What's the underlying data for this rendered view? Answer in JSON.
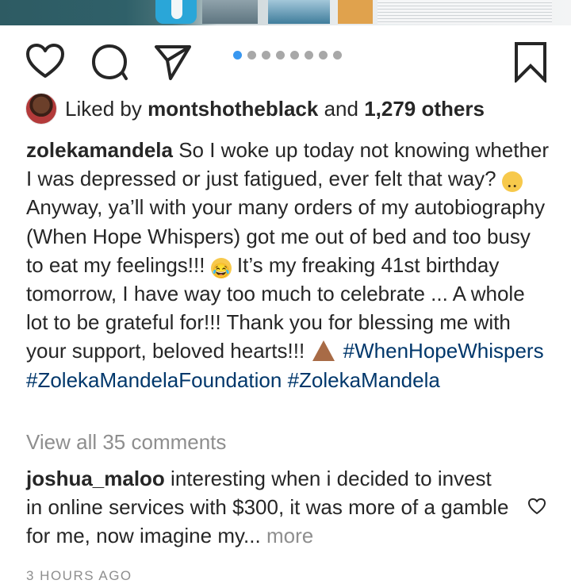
{
  "post": {
    "liked_by_prefix": "Liked by",
    "liked_by_user": "montshotheblack",
    "liked_by_joiner": "and",
    "liked_by_others": "1,279 others",
    "carousel": {
      "total": 8,
      "active_index": 0
    }
  },
  "caption": {
    "username": "zolekamandela",
    "part1": " So I woke up today not knowing whether I was depressed or just fatigued, ever felt that way? ",
    "emoji1": "flushed-face",
    "part2": " Anyway, ya’ll with your many orders of my autobiography (When Hope Whispers) got me out of bed and too busy to eat my feelings!!! ",
    "emoji2": "rolling-laughing-face",
    "part3": " It’s my freaking 41st birthday tomorrow, I have way too much to celebrate ... A whole lot to be grateful for!!! Thank you for blessing me with your support, beloved hearts!!! ",
    "emoji3": "folded-hands",
    "hashtags": [
      "#WhenHopeWhispers",
      "#ZolekaMandelaFoundation",
      "#ZolekaMandela"
    ]
  },
  "view_all_comments": "View all 35 comments",
  "comment": {
    "username": "joshua_maloo",
    "text": " interesting when i decided to invest in online services with $300, it was more of a gamble for me, now imagine my...",
    "more": "more"
  },
  "timestamp": "3 HOURS AGO",
  "colors": {
    "link": "#00376b",
    "accent_dot": "#3897f0",
    "muted": "#8e8e8e"
  },
  "icons": [
    "heart-icon",
    "comment-icon",
    "share-icon",
    "bookmark-icon"
  ]
}
